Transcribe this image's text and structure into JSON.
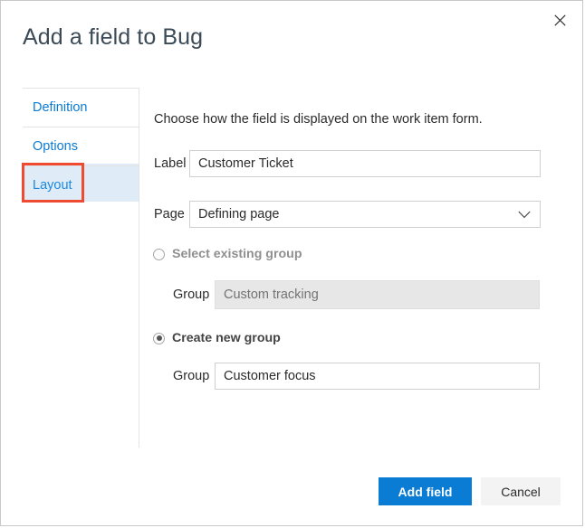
{
  "dialog": {
    "title": "Add a field to Bug",
    "close_icon": "close-icon"
  },
  "sidebar": {
    "items": [
      {
        "label": "Definition",
        "selected": false
      },
      {
        "label": "Options",
        "selected": false
      },
      {
        "label": "Layout",
        "selected": true
      }
    ]
  },
  "main": {
    "intro": "Choose how the field is displayed on the work item form.",
    "label_field": {
      "label": "Label",
      "value": "Customer Ticket",
      "placeholder": ""
    },
    "page_field": {
      "label": "Page",
      "value": "Defining page",
      "chevron_icon": "chevron-down-icon"
    },
    "existing_group": {
      "radio_label": "Select existing group",
      "selected": false,
      "group_label": "Group",
      "group_value": "Custom tracking",
      "disabled": true
    },
    "new_group": {
      "radio_label": "Create new group",
      "selected": true,
      "group_label": "Group",
      "group_value": "Customer focus",
      "disabled": false
    }
  },
  "footer": {
    "primary_label": "Add field",
    "secondary_label": "Cancel"
  },
  "colors": {
    "accent": "#0a7cd4",
    "link": "#0b7bd4",
    "selection": "#dfecf8",
    "annotation": "#ee4b32",
    "border": "#c8c8c8"
  }
}
